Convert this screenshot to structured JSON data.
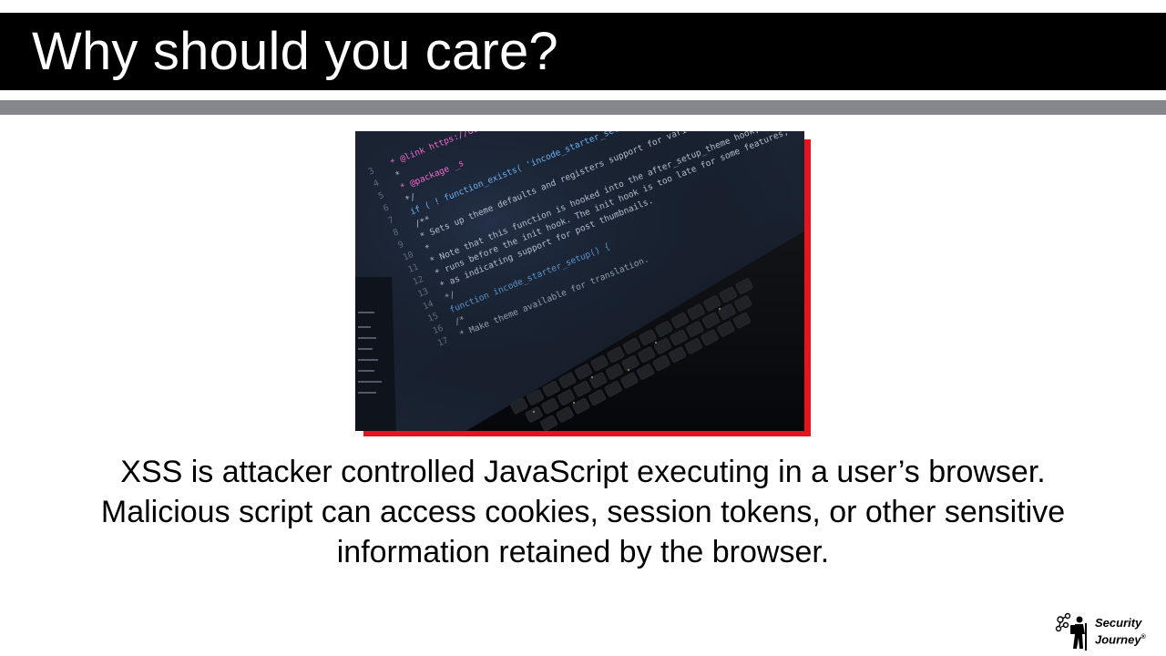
{
  "slide": {
    "title": "Why should you care?",
    "body": "XSS is attacker controlled JavaScript executing in a user’s browser. Malicious script can access cookies, session tokens, or other sensitive information retained by the browser."
  },
  "image": {
    "description_icon": "code-on-laptop-photo",
    "code_lines": [
      "* @link https://deve",
      "*",
      "* @package _s",
      "*/",
      "if ( ! function_exists( 'incode_starter_setup' ) ) :",
      "/**",
      " * Sets up theme defaults and registers support for various WordPress features.",
      " *",
      " * Note that this function is hooked into the after_setup_theme hook, which",
      " * runs before the init hook. The init hook is too late for some features, such",
      " * as indicating support for post thumbnails.",
      " */",
      "function incode_starter_setup() {",
      "  /*",
      "   * Make theme available for translation."
    ],
    "line_numbers": [
      "3",
      "4",
      "5",
      "6",
      "7",
      "8",
      "9",
      "10",
      "11",
      "12",
      "13",
      "14",
      "15",
      "16",
      "17"
    ]
  },
  "logo": {
    "line1": "Security",
    "line2": "Journey",
    "mark": "®"
  },
  "colors": {
    "title_bar": "#000000",
    "rule": "#85878d",
    "accent_shadow": "#e4151c"
  }
}
